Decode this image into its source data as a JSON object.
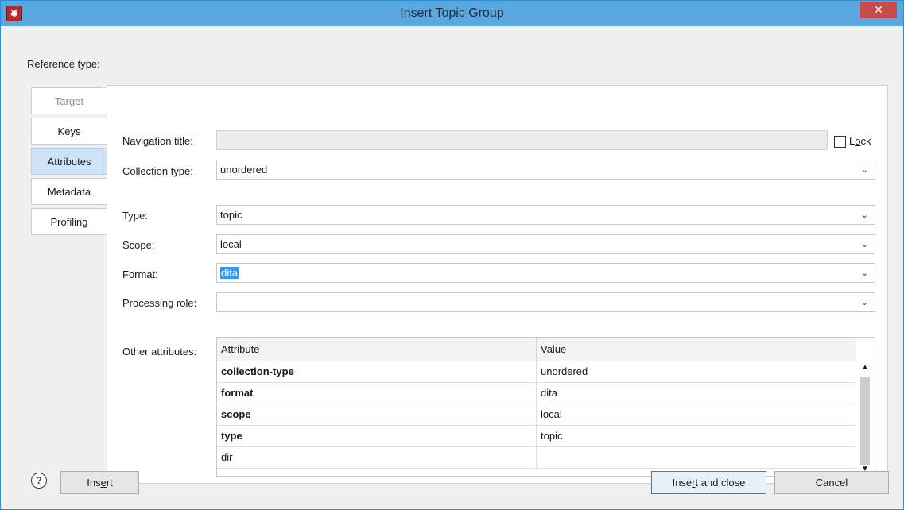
{
  "window": {
    "title": "Insert Topic Group",
    "close_symbol": "✕"
  },
  "reference_type_label": "Reference type:",
  "tabs": [
    {
      "label": "Target",
      "state": "disabled"
    },
    {
      "label": "Keys",
      "state": "normal"
    },
    {
      "label": "Attributes",
      "state": "active"
    },
    {
      "label": "Metadata",
      "state": "normal"
    },
    {
      "label": "Profiling",
      "state": "normal"
    }
  ],
  "form": {
    "navigation_title": {
      "label": "Navigation title:",
      "value": ""
    },
    "lock": {
      "label_prefix": "L",
      "label_underlined": "o",
      "label_suffix": "ck",
      "checked": false
    },
    "collection_type": {
      "label": "Collection type:",
      "value": "unordered"
    },
    "type": {
      "label": "Type:",
      "value": "topic"
    },
    "scope": {
      "label": "Scope:",
      "value": "local"
    },
    "format": {
      "label": "Format:",
      "value": "dita"
    },
    "processing_role": {
      "label": "Processing role:",
      "value": ""
    },
    "other_attributes_label": "Other attributes:"
  },
  "attributes_table": {
    "headers": [
      "Attribute",
      "Value"
    ],
    "rows": [
      {
        "attribute": "collection-type",
        "value": "unordered",
        "bold": true
      },
      {
        "attribute": "format",
        "value": "dita",
        "bold": true
      },
      {
        "attribute": "scope",
        "value": "local",
        "bold": true
      },
      {
        "attribute": "type",
        "value": "topic",
        "bold": true
      },
      {
        "attribute": "dir",
        "value": "",
        "bold": false
      }
    ]
  },
  "buttons": {
    "help": "?",
    "insert": {
      "prefix": "Ins",
      "underlined": "e",
      "suffix": "rt"
    },
    "insert_close": {
      "prefix": "Inse",
      "underlined": "r",
      "suffix": "t and close"
    },
    "cancel": "Cancel"
  },
  "icons": {
    "app": "oxygen-app-icon",
    "chevron": "⌄",
    "scroll_up": "▲",
    "scroll_down": "▼"
  },
  "colors": {
    "titlebar": "#5aa8e0",
    "close": "#c74b4b",
    "active_tab": "#cfe3f7",
    "selection": "#3399ff"
  }
}
